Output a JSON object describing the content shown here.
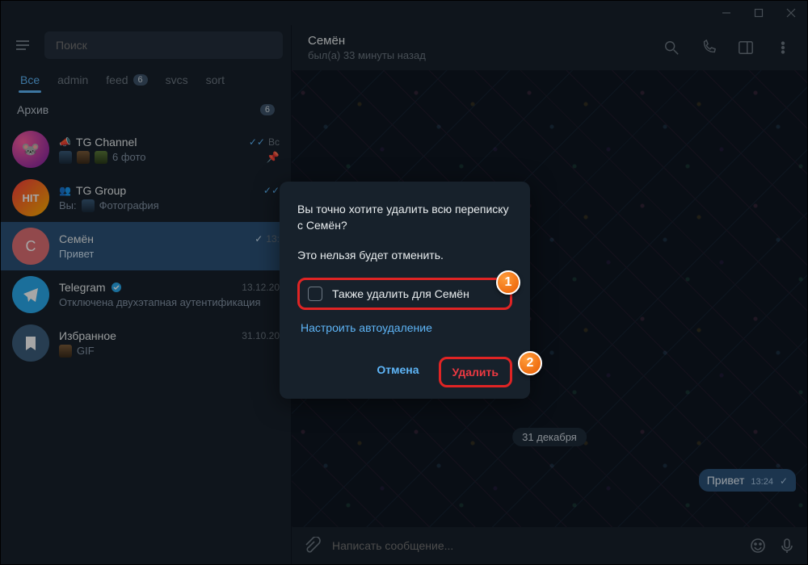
{
  "titlebar": {},
  "sidebar": {
    "search_placeholder": "Поиск",
    "folders": [
      {
        "label": "Все",
        "active": true
      },
      {
        "label": "admin"
      },
      {
        "label": "feed",
        "badge": "6"
      },
      {
        "label": "svcs"
      },
      {
        "label": "sort"
      }
    ],
    "archive": {
      "label": "Архив",
      "badge": "6"
    },
    "chats": [
      {
        "name": "TG Channel",
        "preview": "6 фото",
        "time": "Вс",
        "checks": true,
        "pinned": true,
        "prefix_icon": "megaphone-icon",
        "thumbs": 3
      },
      {
        "name": "TG Group",
        "prefix_self": "Вы:",
        "preview": "Фотография",
        "checks": true,
        "prefix_icon": "group-icon",
        "thumbs": 1
      },
      {
        "name": "Семён",
        "preview": "Привет",
        "time": "13:",
        "checks": true,
        "selected": true
      },
      {
        "name": "Telegram",
        "preview": "Отключена двухэтапная аутентификация",
        "time": "13.12.20",
        "verified": true
      },
      {
        "name": "Избранное",
        "preview": "GIF",
        "time": "31.10.20",
        "thumbs": 1
      }
    ]
  },
  "chat_header": {
    "name": "Семён",
    "status": "был(а) 33 минуты назад"
  },
  "conversation": {
    "date_divider": "31 декабря",
    "out_message": {
      "text": "Привет",
      "time": "13:24"
    }
  },
  "composer": {
    "placeholder": "Написать сообщение..."
  },
  "modal": {
    "line1": "Вы точно хотите удалить всю переписку с Семён?",
    "line2": "Это нельзя будет отменить.",
    "checkbox_label": "Также удалить для Семён",
    "autodelete_link": "Настроить автоудаление",
    "cancel": "Отмена",
    "delete": "Удалить"
  },
  "callouts": {
    "c1": "1",
    "c2": "2"
  }
}
